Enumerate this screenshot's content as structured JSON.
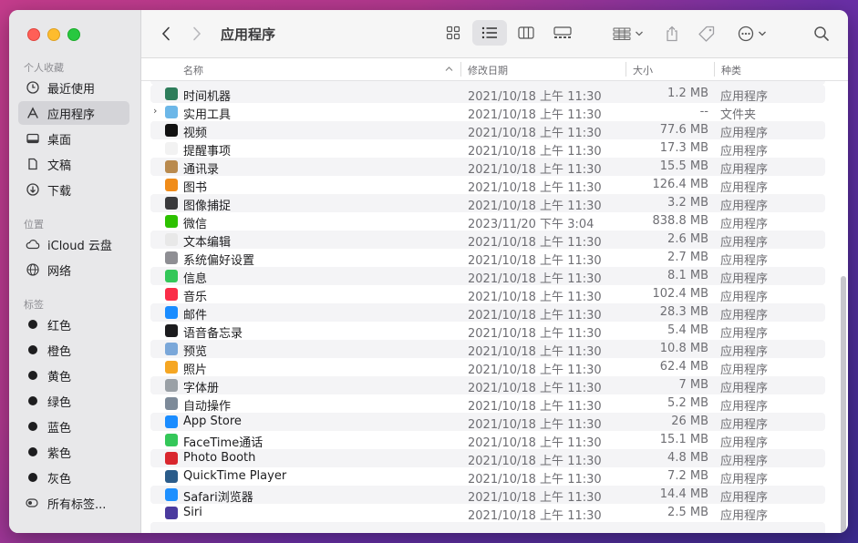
{
  "sidebar": {
    "section_favorites": "个人收藏",
    "favorites": [
      {
        "label": "最近使用",
        "icon": "clock-icon"
      },
      {
        "label": "应用程序",
        "icon": "apps-icon"
      },
      {
        "label": "桌面",
        "icon": "desktop-icon"
      },
      {
        "label": "文稿",
        "icon": "document-icon"
      },
      {
        "label": "下载",
        "icon": "download-icon"
      }
    ],
    "section_locations": "位置",
    "locations": [
      {
        "label": "iCloud 云盘",
        "icon": "cloud-icon"
      },
      {
        "label": "网络",
        "icon": "globe-icon"
      }
    ],
    "section_tags": "标签",
    "tags": [
      {
        "label": "红色"
      },
      {
        "label": "橙色"
      },
      {
        "label": "黄色"
      },
      {
        "label": "绿色"
      },
      {
        "label": "蓝色"
      },
      {
        "label": "紫色"
      },
      {
        "label": "灰色"
      }
    ],
    "all_tags": "所有标签..."
  },
  "toolbar": {
    "title": "应用程序",
    "view_mode": "list"
  },
  "columns": {
    "name": "名称",
    "date": "修改日期",
    "size": "大小",
    "kind": "种类"
  },
  "rows": [
    {
      "name": "时间机器",
      "date": "2021/10/18 上午 11:30",
      "size": "1.2 MB",
      "kind": "应用程序",
      "color": "#2e7d5b"
    },
    {
      "name": "实用工具",
      "date": "2021/10/18 上午 11:30",
      "size": "--",
      "kind": "文件夹",
      "color": "#6cb7e8"
    },
    {
      "name": "视频",
      "date": "2021/10/18 上午 11:30",
      "size": "77.6 MB",
      "kind": "应用程序",
      "color": "#111111"
    },
    {
      "name": "提醒事项",
      "date": "2021/10/18 上午 11:30",
      "size": "17.3 MB",
      "kind": "应用程序",
      "color": "#f2f2f2"
    },
    {
      "name": "通讯录",
      "date": "2021/10/18 上午 11:30",
      "size": "15.5 MB",
      "kind": "应用程序",
      "color": "#b98a4e"
    },
    {
      "name": "图书",
      "date": "2021/10/18 上午 11:30",
      "size": "126.4 MB",
      "kind": "应用程序",
      "color": "#f08c1a"
    },
    {
      "name": "图像捕捉",
      "date": "2021/10/18 上午 11:30",
      "size": "3.2 MB",
      "kind": "应用程序",
      "color": "#3a3a3c"
    },
    {
      "name": "微信",
      "date": "2023/11/20 下午 3:04",
      "size": "838.8 MB",
      "kind": "应用程序",
      "color": "#2dc100"
    },
    {
      "name": "文本编辑",
      "date": "2021/10/18 上午 11:30",
      "size": "2.6 MB",
      "kind": "应用程序",
      "color": "#e8e8e8"
    },
    {
      "name": "系统偏好设置",
      "date": "2021/10/18 上午 11:30",
      "size": "2.7 MB",
      "kind": "应用程序",
      "color": "#8e8e93"
    },
    {
      "name": "信息",
      "date": "2021/10/18 上午 11:30",
      "size": "8.1 MB",
      "kind": "应用程序",
      "color": "#34c759"
    },
    {
      "name": "音乐",
      "date": "2021/10/18 上午 11:30",
      "size": "102.4 MB",
      "kind": "应用程序",
      "color": "#fa2d48"
    },
    {
      "name": "邮件",
      "date": "2021/10/18 上午 11:30",
      "size": "28.3 MB",
      "kind": "应用程序",
      "color": "#1a8cff"
    },
    {
      "name": "语音备忘录",
      "date": "2021/10/18 上午 11:30",
      "size": "5.4 MB",
      "kind": "应用程序",
      "color": "#1c1c1e"
    },
    {
      "name": "预览",
      "date": "2021/10/18 上午 11:30",
      "size": "10.8 MB",
      "kind": "应用程序",
      "color": "#7aa7d9"
    },
    {
      "name": "照片",
      "date": "2021/10/18 上午 11:30",
      "size": "62.4 MB",
      "kind": "应用程序",
      "color": "#f5a623"
    },
    {
      "name": "字体册",
      "date": "2021/10/18 上午 11:30",
      "size": "7 MB",
      "kind": "应用程序",
      "color": "#9aa0a6"
    },
    {
      "name": "自动操作",
      "date": "2021/10/18 上午 11:30",
      "size": "5.2 MB",
      "kind": "应用程序",
      "color": "#7d8a99"
    },
    {
      "name": "App Store",
      "date": "2021/10/18 上午 11:30",
      "size": "26 MB",
      "kind": "应用程序",
      "color": "#1a8cff"
    },
    {
      "name": "FaceTime通话",
      "date": "2021/10/18 上午 11:30",
      "size": "15.1 MB",
      "kind": "应用程序",
      "color": "#34c759"
    },
    {
      "name": "Photo Booth",
      "date": "2021/10/18 上午 11:30",
      "size": "4.8 MB",
      "kind": "应用程序",
      "color": "#d9272e"
    },
    {
      "name": "QuickTime Player",
      "date": "2021/10/18 上午 11:30",
      "size": "7.2 MB",
      "kind": "应用程序",
      "color": "#2b5c8a"
    },
    {
      "name": "Safari浏览器",
      "date": "2021/10/18 上午 11:30",
      "size": "14.4 MB",
      "kind": "应用程序",
      "color": "#1e90ff"
    },
    {
      "name": "Siri",
      "date": "2021/10/18 上午 11:30",
      "size": "2.5 MB",
      "kind": "应用程序",
      "color": "#4a3a9e"
    }
  ]
}
